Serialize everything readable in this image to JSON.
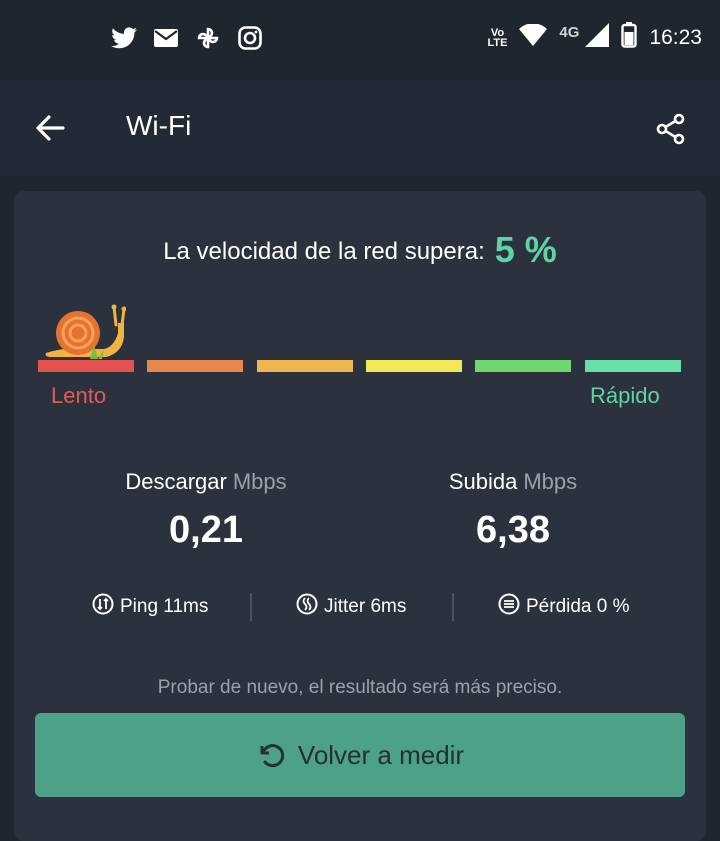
{
  "status_bar": {
    "notification_icons": [
      "twitter-icon",
      "mail-icon",
      "pinwheel-icon",
      "instagram-icon"
    ],
    "volte_label_top": "Vo",
    "volte_label_bottom": "LTE",
    "network_type": "4G",
    "time": "16:23"
  },
  "app_bar": {
    "title": "Wi-Fi"
  },
  "result": {
    "headline": "La velocidad de la red supera:",
    "percentile": "5 %",
    "scale_colors": [
      "#e4514e",
      "#e8874e",
      "#eeb64f",
      "#f1e955",
      "#6ed86e",
      "#66dfaa"
    ],
    "label_slow": "Lento",
    "label_fast": "Rápido"
  },
  "download": {
    "label": "Descargar",
    "unit": "Mbps",
    "value": "0,21"
  },
  "upload": {
    "label": "Subida",
    "unit": "Mbps",
    "value": "6,38"
  },
  "stats": {
    "ping": "Ping 11ms",
    "jitter": "Jitter 6ms",
    "loss": "Pérdida 0 %"
  },
  "hint": "Probar de nuevo, el resultado será más preciso.",
  "remeasure_button": {
    "label": "Volver a medir"
  },
  "colors": {
    "background": "#202630",
    "card": "#2b323e",
    "accent": "#5ed3a7",
    "button": "#4ca188",
    "slow": "#e45a55"
  }
}
